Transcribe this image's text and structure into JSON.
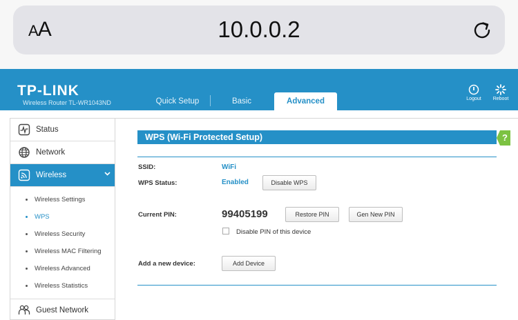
{
  "browser": {
    "aa_label": "AA",
    "url": "10.0.0.2"
  },
  "header": {
    "logo": "TP-LINK",
    "model": "Wireless Router TL-WR1043ND",
    "tabs": [
      {
        "label": "Quick Setup"
      },
      {
        "label": "Basic"
      },
      {
        "label": "Advanced",
        "active": true
      }
    ],
    "logout_label": "Logout",
    "reboot_label": "Reboot"
  },
  "sidebar": {
    "items": [
      {
        "label": "Status",
        "icon": "status-icon"
      },
      {
        "label": "Network",
        "icon": "globe-icon"
      },
      {
        "label": "Wireless",
        "icon": "wifi-icon",
        "active": true
      },
      {
        "label": "Guest Network",
        "icon": "guests-icon"
      }
    ],
    "wireless_sub": [
      {
        "label": "Wireless Settings"
      },
      {
        "label": "WPS",
        "active": true
      },
      {
        "label": "Wireless Security"
      },
      {
        "label": "Wireless MAC Filtering"
      },
      {
        "label": "Wireless Advanced"
      },
      {
        "label": "Wireless Statistics"
      }
    ]
  },
  "main": {
    "title": "WPS (Wi-Fi Protected Setup)",
    "help_label": "?",
    "ssid_label": "SSID:",
    "ssid_value": "WiFi",
    "wps_status_label": "WPS Status:",
    "wps_status_value": "Enabled",
    "disable_wps_button": "Disable WPS",
    "current_pin_label": "Current PIN:",
    "current_pin_value": "99405199",
    "restore_pin_button": "Restore PIN",
    "gen_pin_button": "Gen New PIN",
    "disable_pin_label": "Disable PIN of this device",
    "add_device_label": "Add a new device:",
    "add_device_button": "Add Device"
  },
  "colors": {
    "brand_blue": "#2590c7",
    "help_green": "#7cc242"
  }
}
